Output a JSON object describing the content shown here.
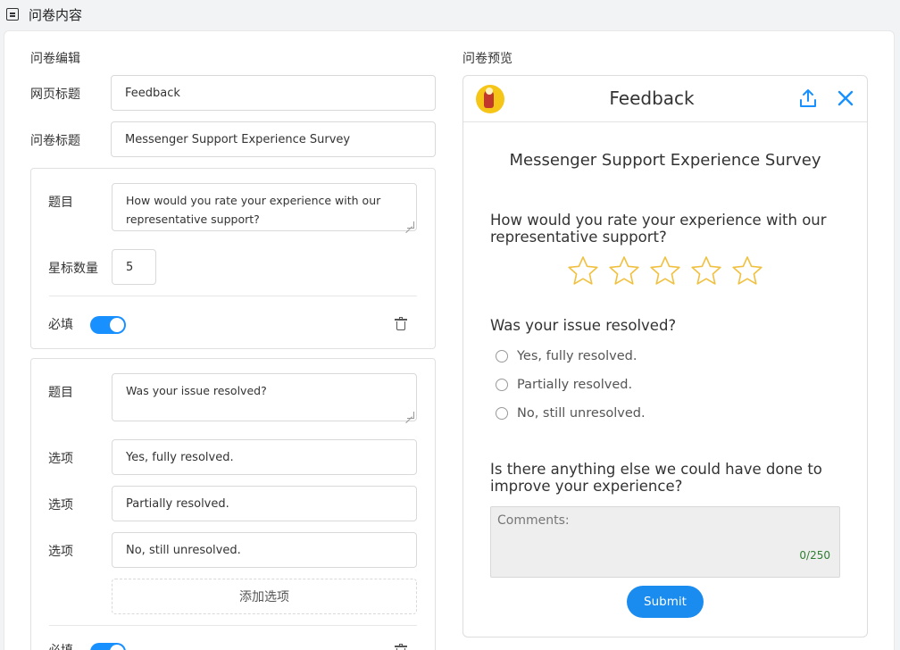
{
  "header": {
    "title": "问卷内容"
  },
  "editor": {
    "section_label": "问卷编辑",
    "page_title_label": "网页标题",
    "page_title_value": "Feedback",
    "survey_title_label": "问卷标题",
    "survey_title_value": "Messenger Support Experience Survey",
    "q1": {
      "question_label": "题目",
      "question_value": "How would you rate your experience with our representative support?",
      "star_count_label": "星标数量",
      "star_count_value": "5",
      "required_label": "必填"
    },
    "q2": {
      "question_label": "题目",
      "question_value": "Was your issue resolved?",
      "option_label": "选项",
      "options": [
        "Yes, fully resolved.",
        "Partially resolved.",
        "No, still unresolved."
      ],
      "add_option_label": "添加选项",
      "required_label": "必填"
    }
  },
  "preview": {
    "section_label": "问卷预览",
    "header_title": "Feedback",
    "survey_title": "Messenger Support Experience Survey",
    "q1_text": "How would you rate your experience with our representative support?",
    "star_count": 5,
    "q2_text": "Was your issue resolved?",
    "q2_options": [
      "Yes, fully resolved.",
      "Partially resolved.",
      "No, still unresolved."
    ],
    "q3_text": "Is there anything else we could have done to improve your experience?",
    "comments_placeholder": "Comments:",
    "char_count": "0/250",
    "submit_label": "Submit"
  },
  "colors": {
    "accent": "#1890ff",
    "star": "#f0c040",
    "counter": "#2e7d32"
  }
}
